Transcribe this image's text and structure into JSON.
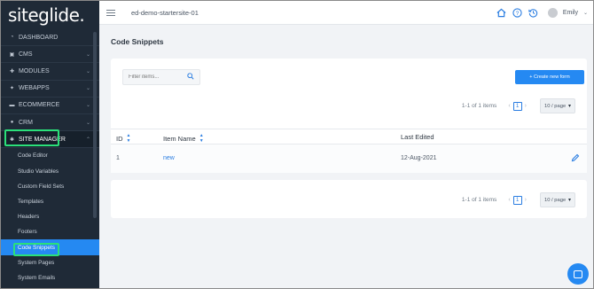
{
  "brand": {
    "logo_text": "siteglide."
  },
  "sidebar": {
    "items": [
      {
        "label": "Dashboard",
        "icon": "dashboard-icon",
        "has_chevron": false
      },
      {
        "label": "CMS",
        "icon": "cms-icon",
        "has_chevron": true
      },
      {
        "label": "Modules",
        "icon": "modules-icon",
        "has_chevron": true
      },
      {
        "label": "WebApps",
        "icon": "webapps-icon",
        "has_chevron": true
      },
      {
        "label": "eCommerce",
        "icon": "ecommerce-icon",
        "has_chevron": true
      },
      {
        "label": "CRM",
        "icon": "crm-icon",
        "has_chevron": true
      },
      {
        "label": "Site Manager",
        "icon": "gear-icon",
        "has_chevron": true,
        "expanded": true
      }
    ],
    "subitems": [
      "Code Editor",
      "Studio Variables",
      "Custom Field Sets",
      "Templates",
      "Headers",
      "Footers",
      "Code Snippets",
      "System Pages",
      "System Emails"
    ],
    "current_subitem": "Code Snippets"
  },
  "topbar": {
    "site_name": "ed-demo-startersite-01",
    "user_name": "Emily"
  },
  "page": {
    "title": "Code Snippets",
    "search_placeholder": "Filter items...",
    "create_button": "+ Create new form"
  },
  "pagination": {
    "count_text": "1-1 of 1 items",
    "prev": "‹",
    "current_page": "1",
    "next": "›",
    "per_page": "10 / page"
  },
  "table": {
    "columns": [
      {
        "label": "ID",
        "sortable": true
      },
      {
        "label": "Item Name",
        "sortable": true
      },
      {
        "label": "Last Edited",
        "sortable": false
      }
    ],
    "rows": [
      {
        "id": "1",
        "name": "new",
        "last_edited": "12-Aug-2021"
      }
    ]
  },
  "colors": {
    "sidebar_bg": "#1f2a37",
    "accent": "#2589f2",
    "highlight_box": "#2be07a",
    "main_bg": "#f1f3f6"
  }
}
